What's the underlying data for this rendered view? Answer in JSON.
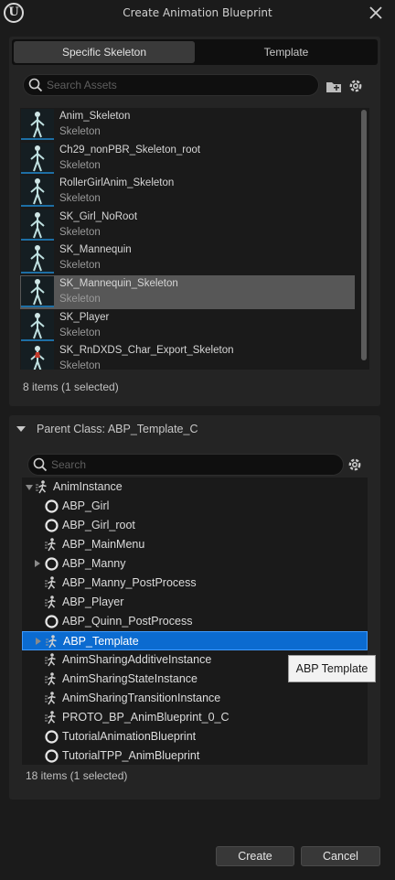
{
  "window": {
    "title": "Create Animation Blueprint"
  },
  "tabs": [
    {
      "label": "Specific Skeleton",
      "active": true
    },
    {
      "label": "Template",
      "active": false
    }
  ],
  "asset_search": {
    "placeholder": "Search Assets"
  },
  "skeletons": [
    {
      "name": "Anim_Skeleton",
      "type": "Skeleton",
      "selected": false
    },
    {
      "name": "Ch29_nonPBR_Skeleton_root",
      "type": "Skeleton",
      "selected": false
    },
    {
      "name": "RollerGirlAnim_Skeleton",
      "type": "Skeleton",
      "selected": false
    },
    {
      "name": "SK_Girl_NoRoot",
      "type": "Skeleton",
      "selected": false
    },
    {
      "name": "SK_Mannequin",
      "type": "Skeleton",
      "selected": false
    },
    {
      "name": "SK_Mannequin_Skeleton",
      "type": "Skeleton",
      "selected": true
    },
    {
      "name": "SK_Player",
      "type": "Skeleton",
      "selected": false
    },
    {
      "name": "SK_RnDXDS_Char_Export_Skeleton",
      "type": "Skeleton",
      "selected": false
    }
  ],
  "skeleton_count": "8 items (1 selected)",
  "parent_class": {
    "label": "Parent Class: ABP_Template_C"
  },
  "class_search": {
    "placeholder": "Search"
  },
  "classes": [
    {
      "name": "AnimInstance",
      "icon": "anim-instance-icon",
      "depth": 0,
      "expander": "down",
      "selected": false
    },
    {
      "name": "ABP_Girl",
      "icon": "circle-icon",
      "depth": 1,
      "expander": "",
      "selected": false
    },
    {
      "name": "ABP_Girl_root",
      "icon": "circle-icon",
      "depth": 1,
      "expander": "",
      "selected": false
    },
    {
      "name": "ABP_MainMenu",
      "icon": "anim-instance-icon",
      "depth": 1,
      "expander": "",
      "selected": false
    },
    {
      "name": "ABP_Manny",
      "icon": "circle-icon",
      "depth": 1,
      "expander": "right",
      "selected": false
    },
    {
      "name": "ABP_Manny_PostProcess",
      "icon": "anim-instance-icon",
      "depth": 1,
      "expander": "",
      "selected": false
    },
    {
      "name": "ABP_Player",
      "icon": "anim-instance-icon",
      "depth": 1,
      "expander": "",
      "selected": false
    },
    {
      "name": "ABP_Quinn_PostProcess",
      "icon": "circle-icon",
      "depth": 1,
      "expander": "",
      "selected": false
    },
    {
      "name": "ABP_Template",
      "icon": "anim-instance-icon",
      "depth": 1,
      "expander": "right",
      "selected": true
    },
    {
      "name": "AnimSharingAdditiveInstance",
      "icon": "anim-instance-icon",
      "depth": 1,
      "expander": "",
      "selected": false
    },
    {
      "name": "AnimSharingStateInstance",
      "icon": "anim-instance-icon",
      "depth": 1,
      "expander": "",
      "selected": false
    },
    {
      "name": "AnimSharingTransitionInstance",
      "icon": "anim-instance-icon",
      "depth": 1,
      "expander": "",
      "selected": false
    },
    {
      "name": "PROTO_BP_AnimBlueprint_0_C",
      "icon": "anim-instance-icon",
      "depth": 1,
      "expander": "",
      "selected": false
    },
    {
      "name": "TutorialAnimationBlueprint",
      "icon": "circle-icon",
      "depth": 1,
      "expander": "",
      "selected": false
    },
    {
      "name": "TutorialTPP_AnimBlueprint",
      "icon": "circle-icon",
      "depth": 1,
      "expander": "",
      "selected": false
    }
  ],
  "class_count": "18 items (1 selected)",
  "tooltip": "ABP Template",
  "buttons": {
    "create": "Create",
    "cancel": "Cancel"
  },
  "colors": {
    "selection": "#0b6bd0",
    "accent_underline": "#1d6fa5",
    "background": "#1b1b1b"
  }
}
